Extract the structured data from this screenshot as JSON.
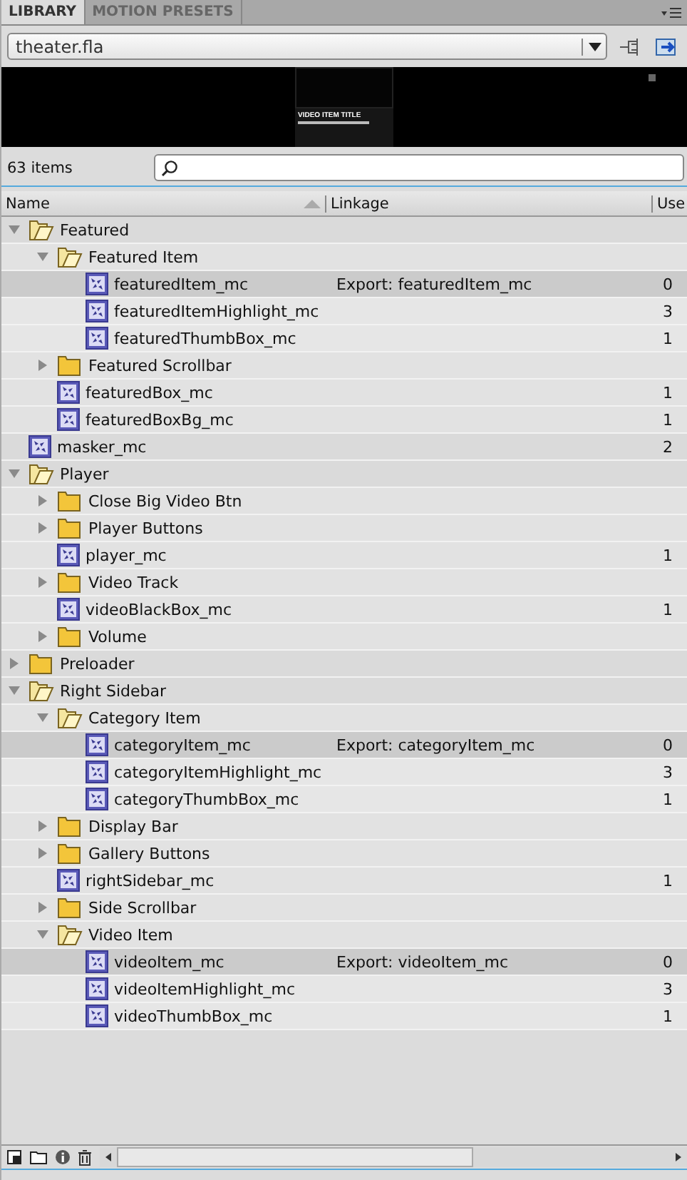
{
  "tabs": [
    {
      "label": "LIBRARY",
      "selected": true
    },
    {
      "label": "MOTION PRESETS",
      "selected": false
    }
  ],
  "document_select": {
    "value": "theater.fla"
  },
  "preview": {
    "title": "VIDEO ITEM TITLE"
  },
  "item_count": "63 items",
  "columns": [
    "Name",
    "Linkage",
    "Use"
  ],
  "tree": [
    {
      "kind": "folder",
      "name": "Featured",
      "expanded": true,
      "selected": false,
      "children": [
        {
          "kind": "folder",
          "name": "Featured Item",
          "expanded": true,
          "selected": false,
          "children": [
            {
              "kind": "symbol",
              "name": "featuredItem_mc",
              "linkage": "Export: featuredItem_mc",
              "use": "0",
              "selected": true
            },
            {
              "kind": "symbol",
              "name": "featuredItemHighlight_mc",
              "use": "3",
              "selected": false
            },
            {
              "kind": "symbol",
              "name": "featuredThumbBox_mc",
              "use": "1",
              "selected": false
            }
          ]
        },
        {
          "kind": "folder",
          "name": "Featured Scrollbar",
          "expanded": false,
          "selected": false
        },
        {
          "kind": "symbol",
          "name": "featuredBox_mc",
          "use": "1",
          "selected": false
        },
        {
          "kind": "symbol",
          "name": "featuredBoxBg_mc",
          "use": "1",
          "selected": false
        }
      ]
    },
    {
      "kind": "symbol",
      "name": "masker_mc",
      "use": "2",
      "selected": false
    },
    {
      "kind": "folder",
      "name": "Player",
      "expanded": true,
      "selected": false,
      "children": [
        {
          "kind": "folder",
          "name": "Close Big Video Btn",
          "expanded": false,
          "selected": false
        },
        {
          "kind": "folder",
          "name": "Player Buttons",
          "expanded": false,
          "selected": false
        },
        {
          "kind": "symbol",
          "name": "player_mc",
          "use": "1",
          "selected": false
        },
        {
          "kind": "folder",
          "name": "Video Track",
          "expanded": false,
          "selected": false
        },
        {
          "kind": "symbol",
          "name": "videoBlackBox_mc",
          "use": "1",
          "selected": false
        },
        {
          "kind": "folder",
          "name": "Volume",
          "expanded": false,
          "selected": false
        }
      ]
    },
    {
      "kind": "folder",
      "name": "Preloader",
      "expanded": false,
      "selected": false
    },
    {
      "kind": "folder",
      "name": "Right Sidebar",
      "expanded": true,
      "selected": false,
      "children": [
        {
          "kind": "folder",
          "name": "Category Item",
          "expanded": true,
          "selected": false,
          "children": [
            {
              "kind": "symbol",
              "name": "categoryItem_mc",
              "linkage": "Export: categoryItem_mc",
              "use": "0",
              "selected": true
            },
            {
              "kind": "symbol",
              "name": "categoryItemHighlight_mc",
              "use": "3",
              "selected": false
            },
            {
              "kind": "symbol",
              "name": "categoryThumbBox_mc",
              "use": "1",
              "selected": false
            }
          ]
        },
        {
          "kind": "folder",
          "name": "Display Bar",
          "expanded": false,
          "selected": false
        },
        {
          "kind": "folder",
          "name": "Gallery Buttons",
          "expanded": false,
          "selected": false
        },
        {
          "kind": "symbol",
          "name": "rightSidebar_mc",
          "use": "1",
          "selected": false
        },
        {
          "kind": "folder",
          "name": "Side Scrollbar",
          "expanded": false,
          "selected": false
        },
        {
          "kind": "folder",
          "name": "Video Item",
          "expanded": true,
          "selected": false,
          "children": [
            {
              "kind": "symbol",
              "name": "videoItem_mc",
              "linkage": "Export: videoItem_mc",
              "use": "0",
              "selected": true
            },
            {
              "kind": "symbol",
              "name": "videoItemHighlight_mc",
              "use": "3",
              "selected": false
            },
            {
              "kind": "symbol",
              "name": "videoThumbBox_mc",
              "use": "1",
              "selected": false
            }
          ]
        }
      ]
    }
  ]
}
